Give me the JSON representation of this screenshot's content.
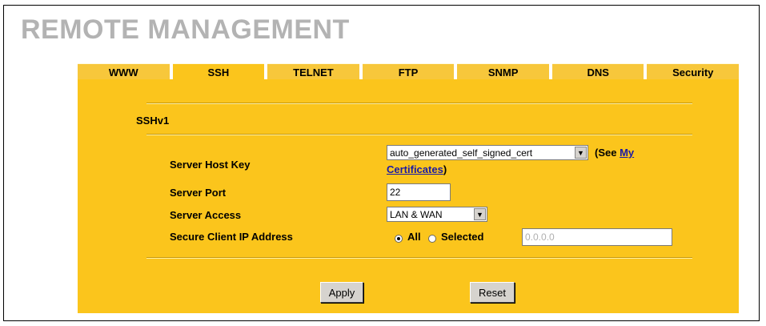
{
  "page_title": "REMOTE MANAGEMENT",
  "tabs": [
    {
      "label": "WWW"
    },
    {
      "label": "SSH"
    },
    {
      "label": "TELNET"
    },
    {
      "label": "FTP"
    },
    {
      "label": "SNMP"
    },
    {
      "label": "DNS"
    },
    {
      "label": "Security"
    }
  ],
  "active_tab": "SSH",
  "section_title": "SSHv1",
  "server_host_key": {
    "label": "Server Host Key",
    "value": "auto_generated_self_signed_cert",
    "see_prefix": "(See ",
    "link_text_1": "My",
    "link_text_2": "Certificates",
    "see_suffix": ")"
  },
  "server_port": {
    "label": "Server Port",
    "value": "22"
  },
  "server_access": {
    "label": "Server Access",
    "value": "LAN & WAN"
  },
  "secure_client_ip": {
    "label": "Secure Client IP Address",
    "option_all": "All",
    "option_selected": "Selected",
    "selected_option": "All",
    "ip_value": "0.0.0.0"
  },
  "buttons": {
    "apply": "Apply",
    "reset": "Reset"
  },
  "colors": {
    "panel": "#fbc51c",
    "title": "#b3b3b3",
    "link": "#1a1aa6"
  }
}
